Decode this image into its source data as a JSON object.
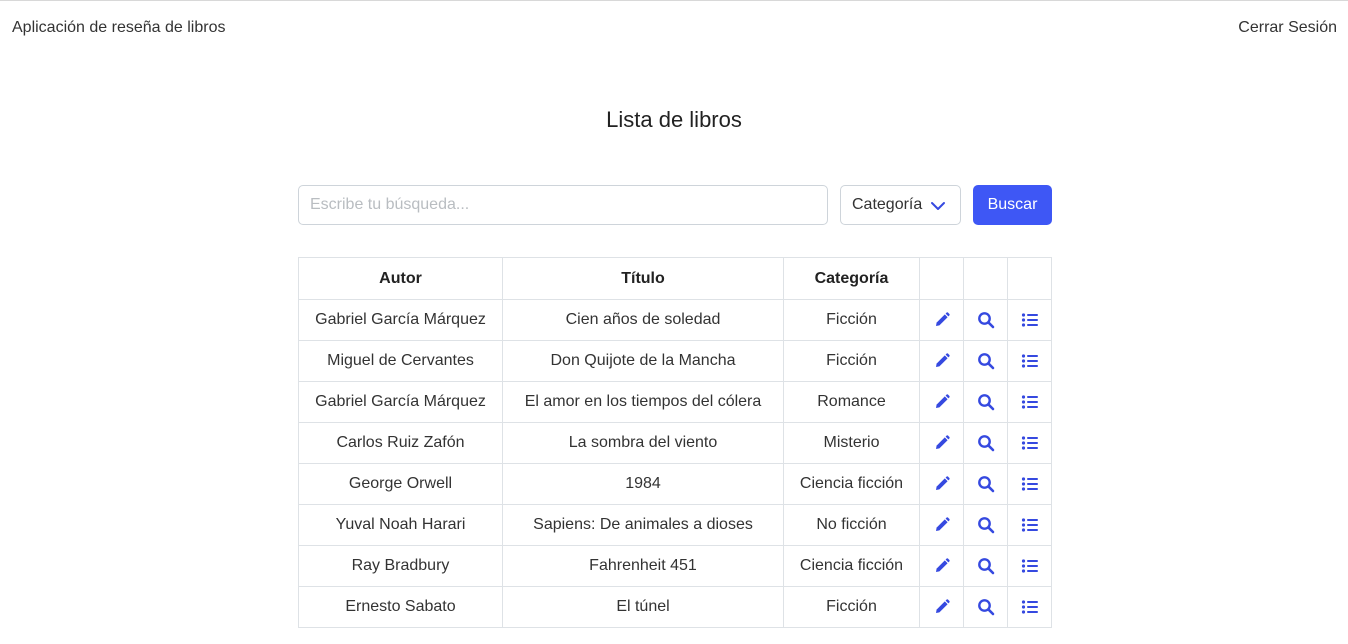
{
  "app": {
    "brand": "Aplicación de reseña de libros",
    "logout": "Cerrar Sesión"
  },
  "page": {
    "title": "Lista de libros"
  },
  "search": {
    "placeholder": "Escribe tu búsqueda...",
    "value": ""
  },
  "category_select": {
    "label": "Categoría",
    "icon": "chevron-down-icon"
  },
  "search_button": {
    "label": "Buscar"
  },
  "colors": {
    "accent": "#3e57f5",
    "icon": "#3549e0"
  },
  "table": {
    "headers": [
      "Autor",
      "Título",
      "Categoría",
      "",
      "",
      ""
    ],
    "action_icons": [
      "pencil-icon",
      "search-icon",
      "list-icon"
    ],
    "rows": [
      {
        "author": "Gabriel García Márquez",
        "title": "Cien años de soledad",
        "category": "Ficción"
      },
      {
        "author": "Miguel de Cervantes",
        "title": "Don Quijote de la Mancha",
        "category": "Ficción"
      },
      {
        "author": "Gabriel García Márquez",
        "title": "El amor en los tiempos del cólera",
        "category": "Romance"
      },
      {
        "author": "Carlos Ruiz Zafón",
        "title": "La sombra del viento",
        "category": "Misterio"
      },
      {
        "author": "George Orwell",
        "title": "1984",
        "category": "Ciencia ficción"
      },
      {
        "author": "Yuval Noah Harari",
        "title": "Sapiens: De animales a dioses",
        "category": "No ficción"
      },
      {
        "author": "Ray Bradbury",
        "title": "Fahrenheit 451",
        "category": "Ciencia ficción"
      },
      {
        "author": "Ernesto Sabato",
        "title": "El túnel",
        "category": "Ficción"
      }
    ]
  }
}
